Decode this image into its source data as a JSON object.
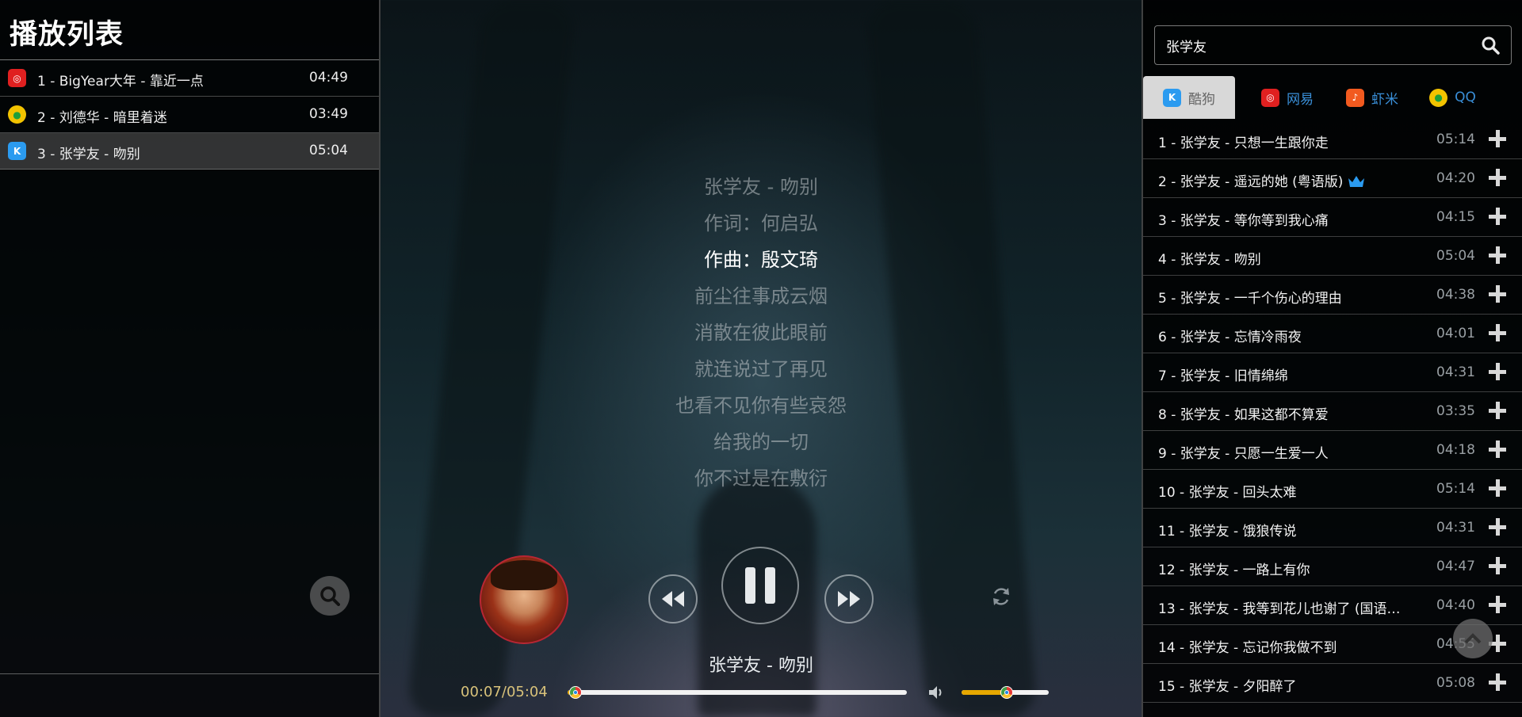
{
  "left": {
    "title": "播放列表",
    "playlist": [
      {
        "source": "netease",
        "name": "1 - BigYear大年 - 靠近一点",
        "duration": "04:49"
      },
      {
        "source": "qq",
        "name": "2 - 刘德华 - 暗里着迷",
        "duration": "03:49"
      },
      {
        "source": "kugou",
        "name": "3 - 张学友 - 吻别",
        "duration": "05:04",
        "active": true
      }
    ]
  },
  "lyrics": {
    "lines": [
      "张学友 - 吻别",
      "作词：何启弘",
      "作曲：殷文琦",
      "前尘往事成云烟",
      "消散在彼此眼前",
      "就连说过了再见",
      "也看不见你有些哀怨",
      "给我的一切",
      "你不过是在敷衍"
    ],
    "current_index": 2
  },
  "player": {
    "now_playing": "张学友 - 吻别",
    "time_display": "00:07/05:04",
    "progress_fraction": 0.023,
    "volume_fraction": 0.52,
    "accent_color": "#e6a800"
  },
  "search": {
    "query": "张学友"
  },
  "tabs": [
    {
      "id": "kugou",
      "label": "酷狗",
      "active": true
    },
    {
      "id": "netease",
      "label": "网易"
    },
    {
      "id": "xiami",
      "label": "虾米"
    },
    {
      "id": "qq",
      "label": "QQ"
    }
  ],
  "results": [
    {
      "name": "1 - 张学友 - 只想一生跟你走",
      "duration": "05:14"
    },
    {
      "name": "2 - 张学友 - 遥远的她 (粤语版)",
      "duration": "04:20",
      "vip": true
    },
    {
      "name": "3 - 张学友 - 等你等到我心痛",
      "duration": "04:15"
    },
    {
      "name": "4 - 张学友 - 吻别",
      "duration": "05:04"
    },
    {
      "name": "5 - 张学友 - 一千个伤心的理由",
      "duration": "04:38"
    },
    {
      "name": "6 - 张学友 - 忘情冷雨夜",
      "duration": "04:01"
    },
    {
      "name": "7 - 张学友 - 旧情绵绵",
      "duration": "04:31"
    },
    {
      "name": "8 - 张学友 - 如果这都不算爱",
      "duration": "03:35"
    },
    {
      "name": "9 - 张学友 - 只愿一生爱一人",
      "duration": "04:18"
    },
    {
      "name": "10 - 张学友 - 回头太难",
      "duration": "05:14"
    },
    {
      "name": "11 - 张学友 - 饿狼传说",
      "duration": "04:31"
    },
    {
      "name": "12 - 张学友 - 一路上有你",
      "duration": "04:47"
    },
    {
      "name": "13 - 张学友 - 我等到花儿也谢了 (国语…",
      "duration": "04:40"
    },
    {
      "name": "14 - 张学友 - 忘记你我做不到",
      "duration": "04:55"
    },
    {
      "name": "15 - 张学友 - 夕阳醉了",
      "duration": "05:08"
    }
  ]
}
